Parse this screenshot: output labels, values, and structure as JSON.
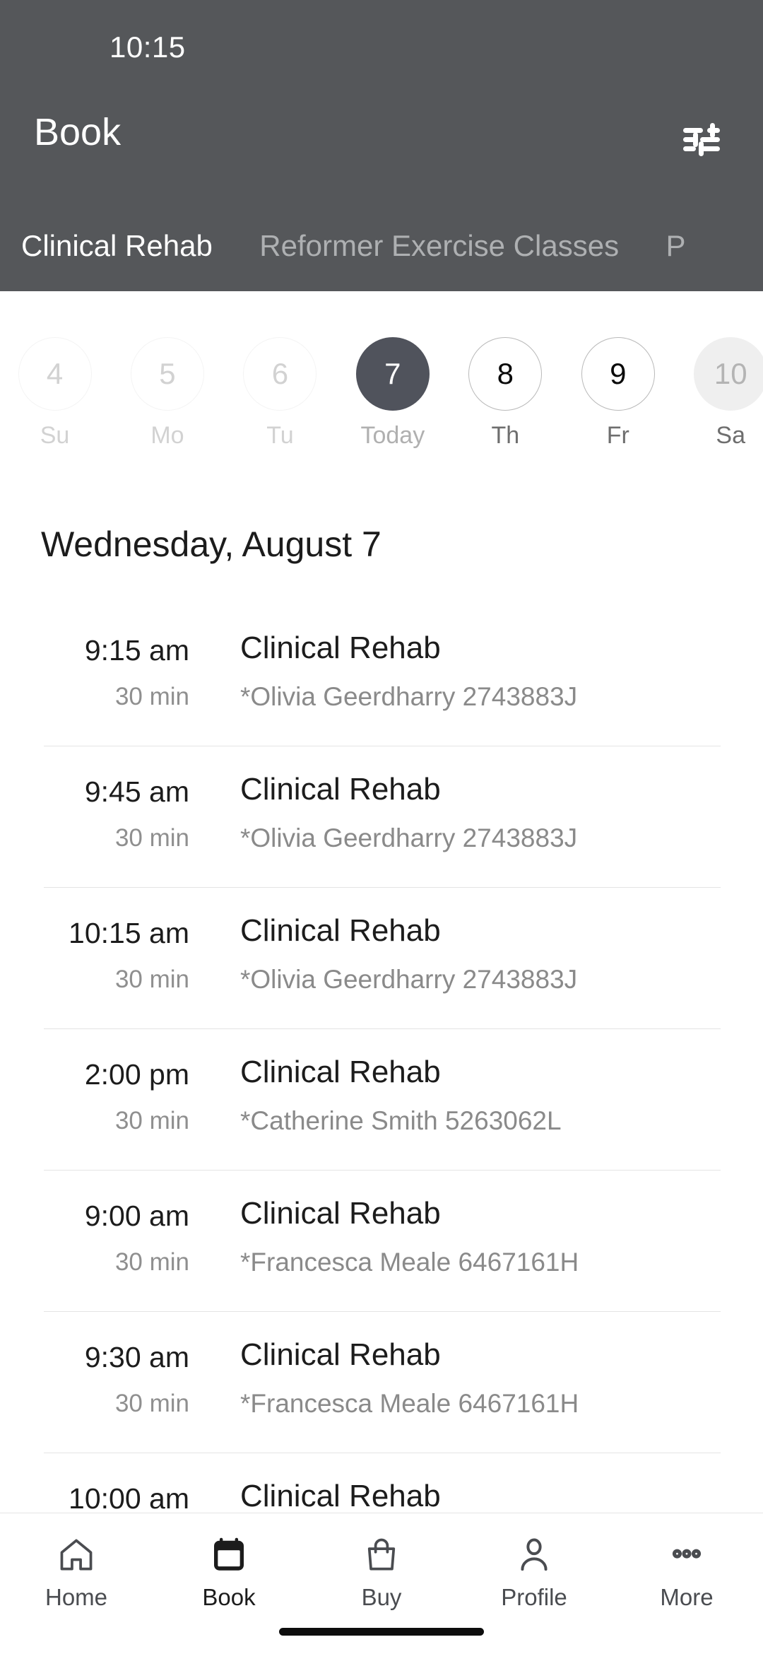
{
  "status_bar": {
    "time": "10:15"
  },
  "app_bar": {
    "title": "Book",
    "filter_icon": "tune-filter-icon"
  },
  "tabs": [
    {
      "label": "Clinical Rehab",
      "active": true
    },
    {
      "label": "Reformer Exercise Classes",
      "active": false
    },
    {
      "label": "P",
      "active": false
    }
  ],
  "date_strip": [
    {
      "day_number": "4",
      "day_label": "Su",
      "state": "past"
    },
    {
      "day_number": "5",
      "day_label": "Mo",
      "state": "past"
    },
    {
      "day_number": "6",
      "day_label": "Tu",
      "state": "past"
    },
    {
      "day_number": "7",
      "day_label": "Today",
      "state": "selected"
    },
    {
      "day_number": "8",
      "day_label": "Th",
      "state": "available"
    },
    {
      "day_number": "9",
      "day_label": "Fr",
      "state": "available"
    },
    {
      "day_number": "10",
      "day_label": "Sa",
      "state": "filled"
    }
  ],
  "day_heading": "Wednesday, August 7",
  "appointments": [
    {
      "time": "9:15 am",
      "duration": "30 min",
      "title": "Clinical Rehab",
      "subtitle": "*Olivia Geerdharry 2743883J"
    },
    {
      "time": "9:45 am",
      "duration": "30 min",
      "title": "Clinical Rehab",
      "subtitle": "*Olivia Geerdharry 2743883J"
    },
    {
      "time": "10:15 am",
      "duration": "30 min",
      "title": "Clinical Rehab",
      "subtitle": "*Olivia Geerdharry 2743883J"
    },
    {
      "time": "2:00 pm",
      "duration": "30 min",
      "title": "Clinical Rehab",
      "subtitle": "*Catherine Smith 5263062L"
    },
    {
      "time": "9:00 am",
      "duration": "30 min",
      "title": "Clinical Rehab",
      "subtitle": "*Francesca Meale 6467161H"
    },
    {
      "time": "9:30 am",
      "duration": "30 min",
      "title": "Clinical Rehab",
      "subtitle": "*Francesca Meale 6467161H"
    },
    {
      "time": "10:00 am",
      "duration": "",
      "title": "Clinical Rehab",
      "subtitle": ""
    }
  ],
  "bottom_nav": [
    {
      "label": "Home",
      "icon": "home-icon",
      "active": false
    },
    {
      "label": "Book",
      "icon": "calendar-icon",
      "active": true
    },
    {
      "label": "Buy",
      "icon": "bag-icon",
      "active": false
    },
    {
      "label": "Profile",
      "icon": "person-icon",
      "active": false
    },
    {
      "label": "More",
      "icon": "ellipsis-icon",
      "active": false
    }
  ],
  "colors": {
    "header_bg": "#55575a",
    "selected_date_bg": "#50535c",
    "tab_active": "#ffffff",
    "tab_inactive": "#aeb0b2",
    "divider": "#e4e4e4"
  }
}
